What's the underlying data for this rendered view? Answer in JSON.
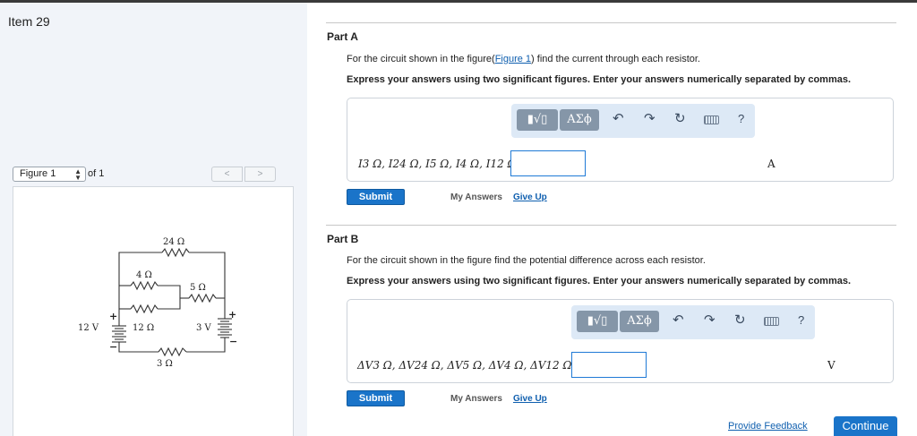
{
  "item_title": "Item 29",
  "figure_nav": {
    "select_value": "Figure 1",
    "of_label": "of 1",
    "prev": "<",
    "next": ">"
  },
  "circuit": {
    "r24": "24 Ω",
    "r4": "4 Ω",
    "r5": "5 Ω",
    "r12": "12 Ω",
    "r3": "3 Ω",
    "v12": "12 V",
    "v3": "3 V",
    "plus": "+",
    "minus": "−"
  },
  "partA": {
    "title": "Part A",
    "q_before": "For the circuit shown in the figure(",
    "q_link": "Figure 1",
    "q_after": ") find the current through each resistor.",
    "instruction": "Express your answers using two significant figures. Enter your answers numerically separated by commas.",
    "formula": "I3 Ω, I24 Ω, I5 Ω, I4 Ω, I12 Ω =",
    "unit": "A",
    "input_value": "",
    "submit": "Submit",
    "my_answers": "My Answers",
    "give_up": "Give Up"
  },
  "partB": {
    "title": "Part B",
    "question": "For the circuit shown in the figure find the potential difference across each resistor.",
    "instruction": "Express your answers using two significant figures. Enter your answers numerically separated by commas.",
    "formula": "ΔV3 Ω, ΔV24 Ω, ΔV5 Ω, ΔV4 Ω, ΔV12 Ω =",
    "unit": "V",
    "input_value": "",
    "submit": "Submit",
    "my_answers": "My Answers",
    "give_up": "Give Up"
  },
  "toolbar": {
    "templates": "▮√▯",
    "symbols": "ΑΣϕ",
    "undo_icon": "undo-icon",
    "redo_icon": "redo-icon",
    "reset_icon": "reset-icon",
    "keyboard_icon": "keyboard-icon",
    "help": "?"
  },
  "footer": {
    "feedback": "Provide Feedback",
    "continue": "Continue"
  },
  "colors": {
    "accent": "#1a74c9",
    "link": "#0f5faf",
    "left_panel": "#f1f4f9",
    "toolbar_bg": "#dde9f6"
  }
}
